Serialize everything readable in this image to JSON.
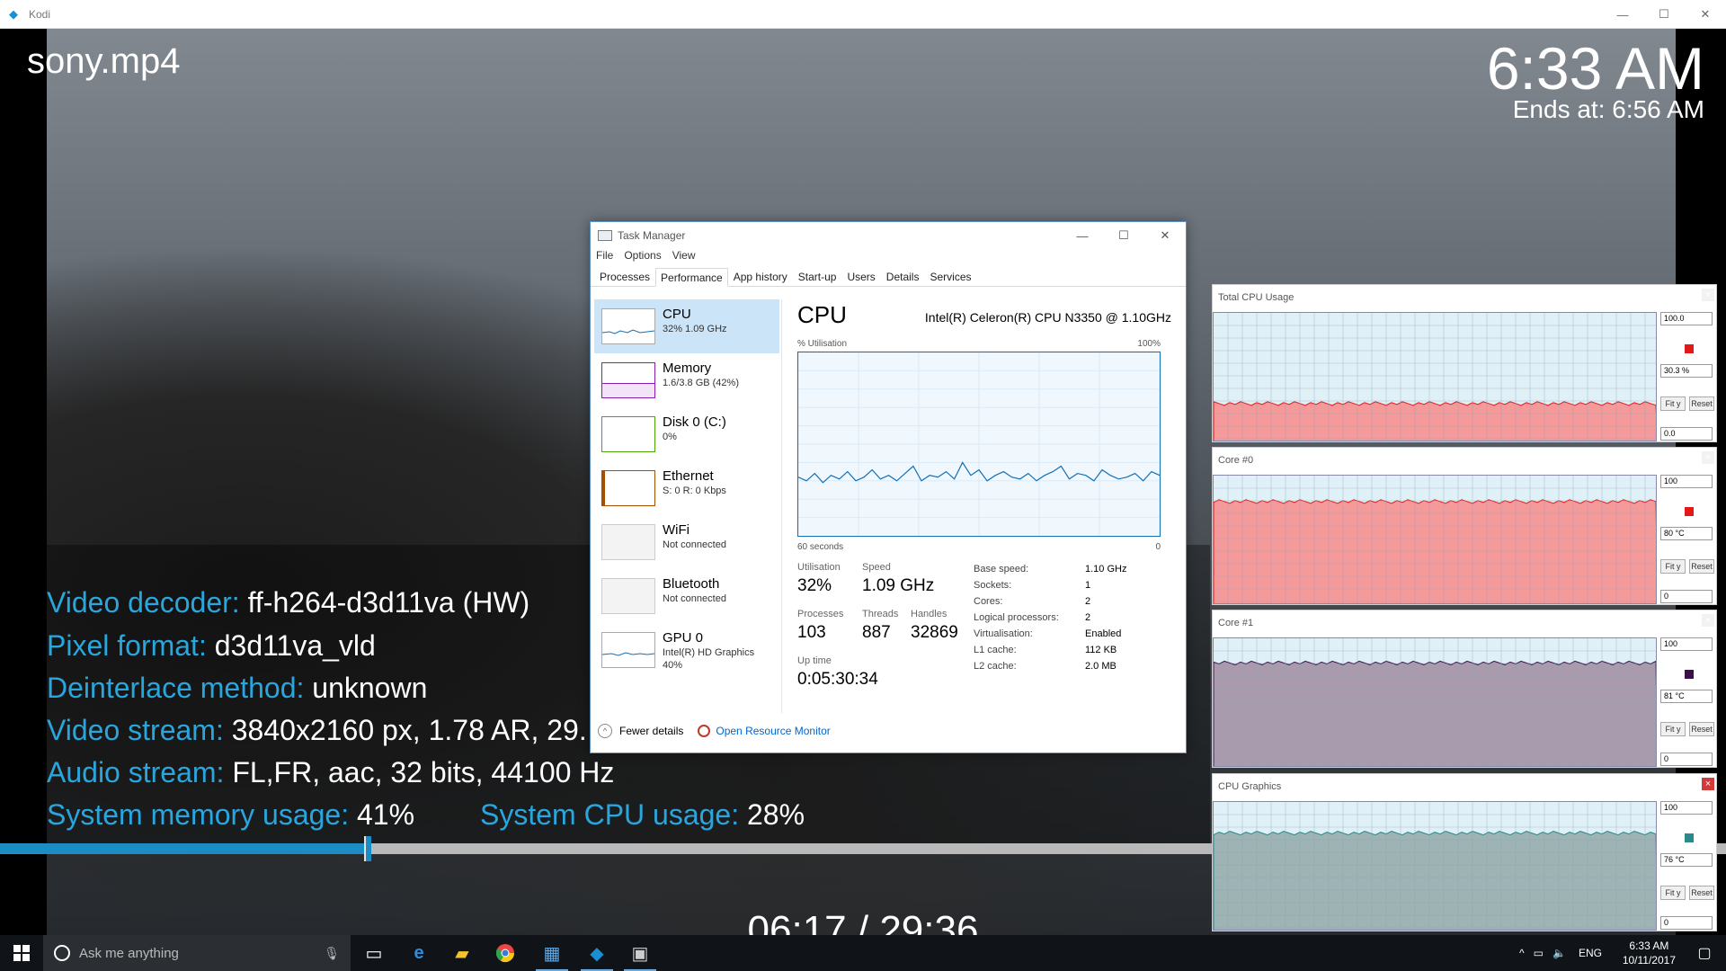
{
  "kodi": {
    "window_title": "Kodi",
    "controls": {
      "minimize": "—",
      "maximize": "☐",
      "close": "✕"
    },
    "osd": {
      "title": "sony.mp4",
      "clock": "6:33 AM",
      "ends_at": "Ends at: 6:56 AM",
      "timecode": "06:17 / 29:36",
      "progress_fraction": 0.213
    },
    "codec_info": [
      {
        "key": "Video decoder:",
        "value": " ff-h264-d3d11va (HW)"
      },
      {
        "key": "Pixel format:",
        "value": " d3d11va_vld"
      },
      {
        "key": "Deinterlace method:",
        "value": " unknown"
      },
      {
        "key": "Video stream:",
        "value": " 3840x2160 px, 1.78 AR, 29."
      },
      {
        "key": "Audio stream:",
        "value": " FL,FR, aac, 32 bits, 44100 Hz"
      }
    ],
    "memory_key": "System memory usage:",
    "memory_val": " 41%",
    "cpu_key": "System CPU usage:",
    "cpu_val": " 28%"
  },
  "taskmgr": {
    "title": "Task Manager",
    "menu": [
      "File",
      "Options",
      "View"
    ],
    "tabs": [
      "Processes",
      "Performance",
      "App history",
      "Start-up",
      "Users",
      "Details",
      "Services"
    ],
    "active_tab": 1,
    "sidebar": [
      {
        "name": "CPU",
        "sub": "32% 1.09 GHz",
        "color": "#1170b8"
      },
      {
        "name": "Memory",
        "sub": "1.6/3.8 GB (42%)",
        "color": "#8b1bb5"
      },
      {
        "name": "Disk 0 (C:)",
        "sub": "0%",
        "color": "#4da60c"
      },
      {
        "name": "Ethernet",
        "sub": "S: 0 R: 0 Kbps",
        "color": "#a74f01"
      },
      {
        "name": "WiFi",
        "sub": "Not connected",
        "color": "#aaaaaa"
      },
      {
        "name": "Bluetooth",
        "sub": "Not connected",
        "color": "#aaaaaa"
      },
      {
        "name": "GPU 0",
        "sub": "Intel(R) HD Graphics",
        "sub2": "40%",
        "color": "#1170b8"
      }
    ],
    "heading": "CPU",
    "model": "Intel(R) Celeron(R) CPU N3350 @ 1.10GHz",
    "graph_label": "% Utilisation",
    "graph_max": "100%",
    "graph_time": "60 seconds",
    "graph_min": "0",
    "stats": {
      "util_label": "Utilisation",
      "util": "32%",
      "speed_label": "Speed",
      "speed": "1.09 GHz",
      "proc_label": "Processes",
      "proc": "103",
      "threads_label": "Threads",
      "threads": "887",
      "handles_label": "Handles",
      "handles": "32869",
      "uptime_label": "Up time",
      "uptime": "0:05:30:34"
    },
    "specs": [
      {
        "k": "Base speed:",
        "v": "1.10 GHz"
      },
      {
        "k": "Sockets:",
        "v": "1"
      },
      {
        "k": "Cores:",
        "v": "2"
      },
      {
        "k": "Logical processors:",
        "v": "2"
      },
      {
        "k": "Virtualisation:",
        "v": "Enabled"
      },
      {
        "k": "L1 cache:",
        "v": "112 KB"
      },
      {
        "k": "L2 cache:",
        "v": "2.0 MB"
      }
    ],
    "fewer_details": "Fewer details",
    "resource_monitor": "Open Resource Monitor",
    "cpu_history": [
      32,
      30,
      34,
      29,
      33,
      31,
      35,
      30,
      32,
      36,
      31,
      33,
      30,
      34,
      38,
      30,
      33,
      32,
      35,
      31,
      40,
      33,
      36,
      30,
      33,
      35,
      32,
      31,
      34,
      30,
      33,
      35,
      38,
      31,
      34,
      33,
      30,
      36,
      33,
      31,
      32,
      34,
      30,
      35,
      33
    ]
  },
  "gadgets": [
    {
      "title": "Total CPU Usage",
      "top": "100.0",
      "mid": "30.3 %",
      "bottom": "0.0",
      "fill": "#f59a9a",
      "square": "#e31919",
      "level": 0.3,
      "close_red": false
    },
    {
      "title": "Core #0",
      "top": "100",
      "mid": "80 °C",
      "bottom": "0",
      "fill": "#f59a9a",
      "square": "#e31919",
      "level": 0.8,
      "close_red": false
    },
    {
      "title": "Core #1",
      "top": "100",
      "mid": "81 °C",
      "bottom": "0",
      "fill": "#a99aac",
      "square": "#3b1048",
      "level": 0.81,
      "close_red": false
    },
    {
      "title": "CPU Graphics",
      "top": "100",
      "mid": "76 °C",
      "bottom": "0",
      "fill": "#9eb3b3",
      "square": "#2a8a8a",
      "level": 0.76,
      "close_red": true
    }
  ],
  "gadget_buttons": {
    "fit": "Fit y",
    "reset": "Reset",
    "close": "×"
  },
  "taskbar": {
    "search_placeholder": "Ask me anything",
    "lang": "ENG",
    "time": "6:33 AM",
    "date": "10/11/2017"
  }
}
